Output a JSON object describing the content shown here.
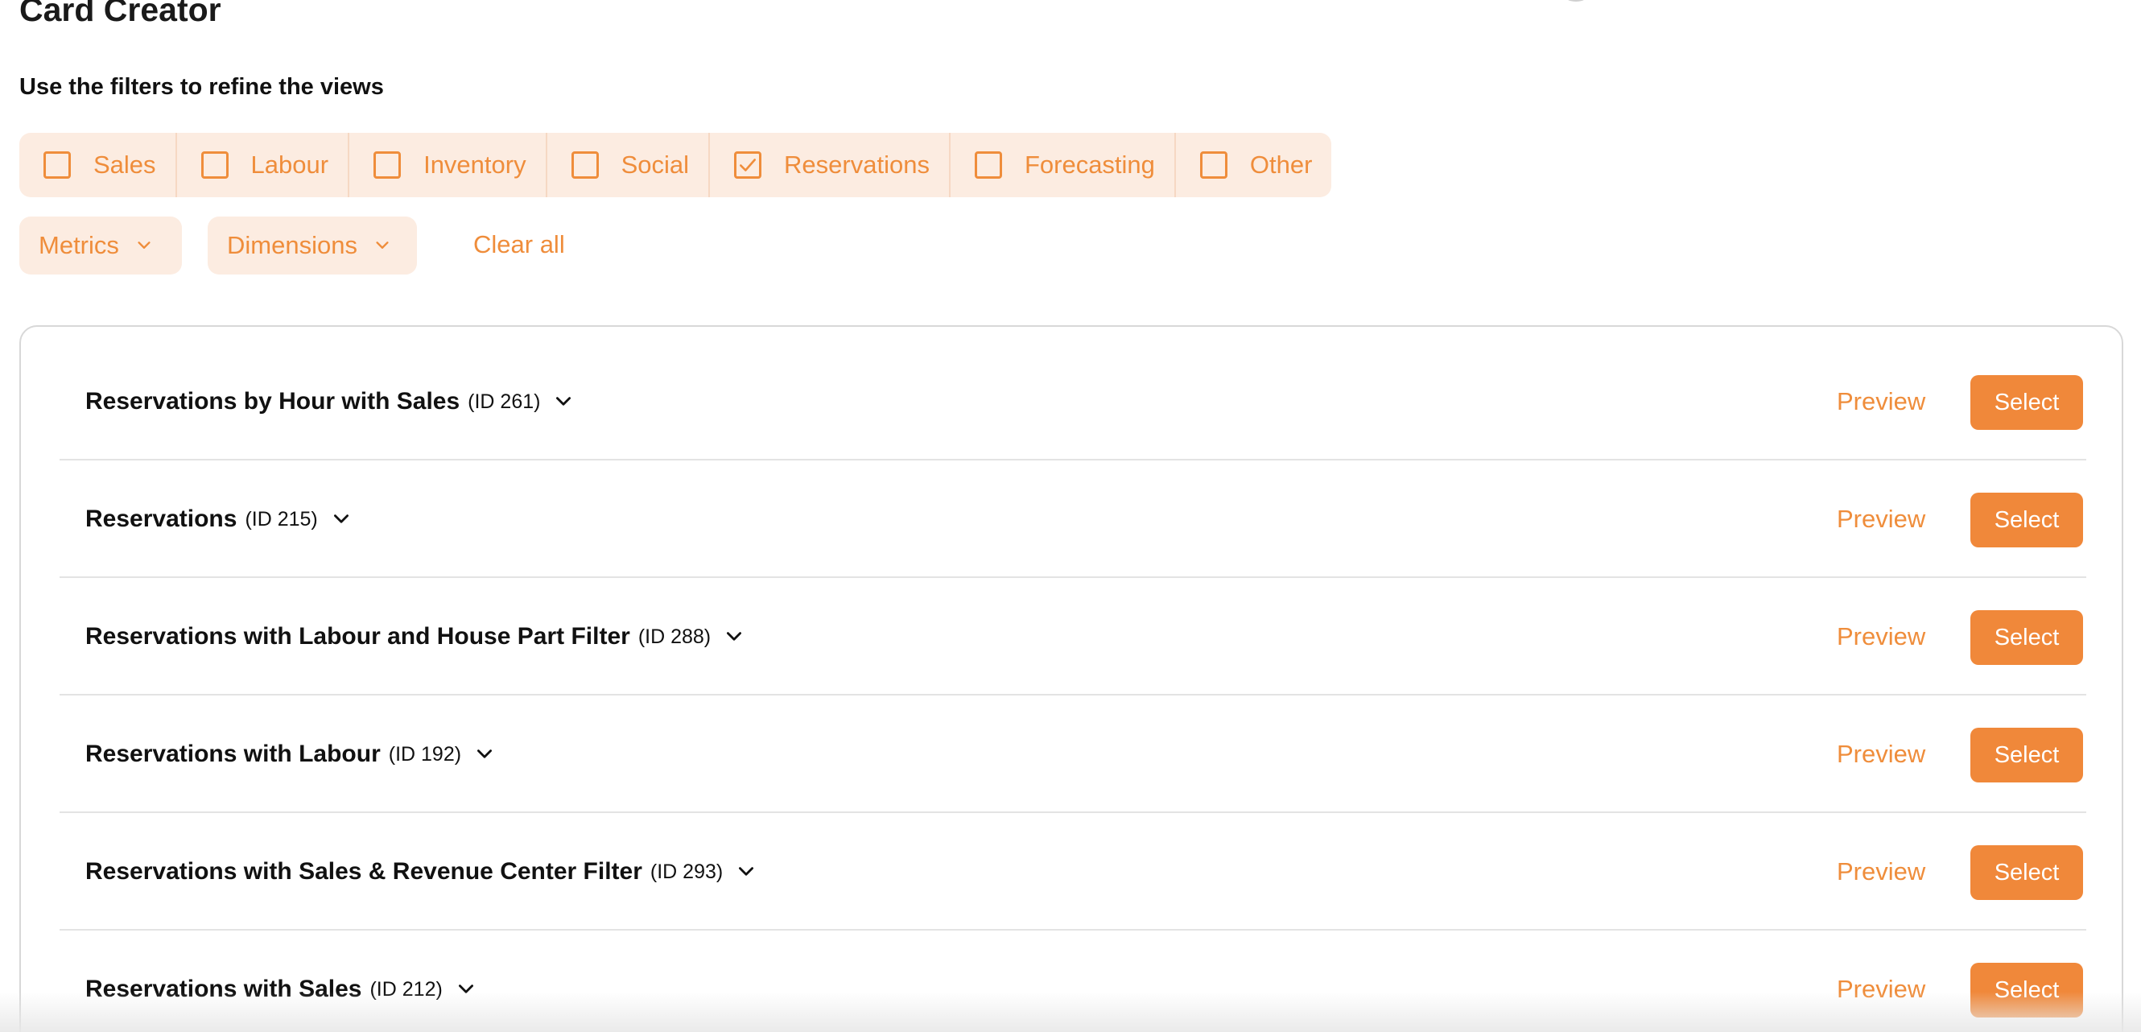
{
  "header": {
    "title": "Card Creator",
    "subtitle": "Use the filters to refine the views"
  },
  "categories": [
    {
      "label": "Sales",
      "checked": false
    },
    {
      "label": "Labour",
      "checked": false
    },
    {
      "label": "Inventory",
      "checked": false
    },
    {
      "label": "Social",
      "checked": false
    },
    {
      "label": "Reservations",
      "checked": true
    },
    {
      "label": "Forecasting",
      "checked": false
    },
    {
      "label": "Other",
      "checked": false
    }
  ],
  "filters": {
    "metrics_label": "Metrics",
    "dimensions_label": "Dimensions",
    "clear_all_label": "Clear all"
  },
  "views": [
    {
      "title": "Reservations by Hour with Sales",
      "id": "(ID 261)",
      "preview_label": "Preview",
      "select_label": "Select"
    },
    {
      "title": "Reservations",
      "id": "(ID 215)",
      "preview_label": "Preview",
      "select_label": "Select"
    },
    {
      "title": "Reservations with Labour and House Part Filter",
      "id": "(ID 288)",
      "preview_label": "Preview",
      "select_label": "Select"
    },
    {
      "title": "Reservations with Labour",
      "id": "(ID 192)",
      "preview_label": "Preview",
      "select_label": "Select"
    },
    {
      "title": "Reservations with Sales & Revenue Center Filter",
      "id": "(ID 293)",
      "preview_label": "Preview",
      "select_label": "Select"
    },
    {
      "title": "Reservations with Sales",
      "id": "(ID 212)",
      "preview_label": "Preview",
      "select_label": "Select"
    }
  ],
  "colors": {
    "accent": "#f0883a",
    "accent_text": "#ef8d3b",
    "chip_background": "#fcece1"
  },
  "icons": {
    "checkbox_checked": "check-icon",
    "dropdown": "chevron-down-icon",
    "row_expand": "chevron-down-icon"
  }
}
